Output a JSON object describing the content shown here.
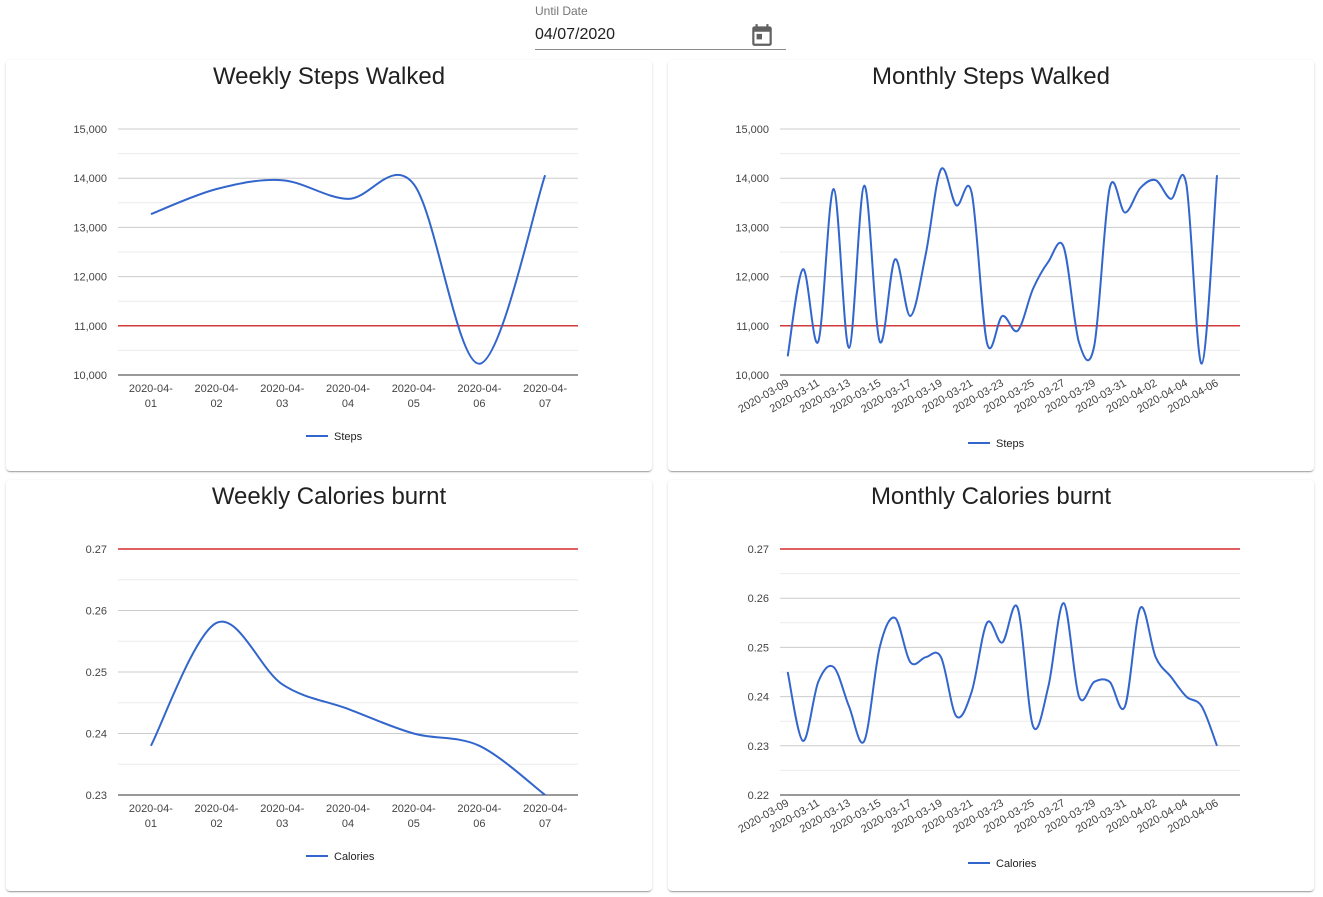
{
  "date_picker": {
    "label": "Until Date",
    "value": "04/07/2020",
    "icon": "calendar-icon"
  },
  "colors": {
    "series": "#3366cc",
    "threshold": "#cc0000",
    "grid": "#cccccc",
    "minor_grid": "#ebebeb"
  },
  "cards": {
    "weekly_steps": {
      "title": "Weekly Steps Walked"
    },
    "monthly_steps": {
      "title": "Monthly Steps Walked"
    },
    "weekly_calories": {
      "title": "Weekly Calories burnt"
    },
    "monthly_calories": {
      "title": "Monthly Calories burnt"
    }
  },
  "chart_data": [
    {
      "id": "weekly_steps",
      "type": "line",
      "title": "Weekly Steps Walked",
      "categories": [
        "2020-04-01",
        "2020-04-02",
        "2020-04-03",
        "2020-04-04",
        "2020-04-05",
        "2020-04-06",
        "2020-04-07"
      ],
      "category_lines": [
        [
          "2020-04-",
          "01"
        ],
        [
          "2020-04-",
          "02"
        ],
        [
          "2020-04-",
          "03"
        ],
        [
          "2020-04-",
          "04"
        ],
        [
          "2020-04-",
          "05"
        ],
        [
          "2020-04-",
          "06"
        ],
        [
          "2020-04-",
          "07"
        ]
      ],
      "series": [
        {
          "name": "Steps",
          "values": [
            13270,
            13780,
            13960,
            13580,
            13880,
            10230,
            14060
          ]
        }
      ],
      "threshold": 11000,
      "ylim": [
        10000,
        15000
      ],
      "yticks": [
        10000,
        11000,
        12000,
        13000,
        14000,
        15000
      ],
      "ytick_labels": [
        "10,000",
        "11,000",
        "12,000",
        "13,000",
        "14,000",
        "15,000"
      ],
      "xlabel_style": "wrap",
      "legend_position": "bottom",
      "grid": true
    },
    {
      "id": "monthly_steps",
      "type": "line",
      "title": "Monthly Steps Walked",
      "categories": [
        "2020-03-09",
        "2020-03-10",
        "2020-03-11",
        "2020-03-12",
        "2020-03-13",
        "2020-03-14",
        "2020-03-15",
        "2020-03-16",
        "2020-03-17",
        "2020-03-18",
        "2020-03-19",
        "2020-03-20",
        "2020-03-21",
        "2020-03-22",
        "2020-03-23",
        "2020-03-24",
        "2020-03-25",
        "2020-03-26",
        "2020-03-27",
        "2020-03-28",
        "2020-03-29",
        "2020-03-30",
        "2020-03-31",
        "2020-04-01",
        "2020-04-02",
        "2020-04-03",
        "2020-04-04",
        "2020-04-05",
        "2020-04-06",
        "2020-04-07"
      ],
      "category_labels": [
        "2020-03-09",
        "",
        "2020-03-11",
        "",
        "2020-03-13",
        "",
        "2020-03-15",
        "",
        "2020-03-17",
        "",
        "2020-03-19",
        "",
        "2020-03-21",
        "",
        "2020-03-23",
        "",
        "2020-03-25",
        "",
        "2020-03-27",
        "",
        "2020-03-29",
        "",
        "2020-03-31",
        "",
        "2020-04-02",
        "",
        "2020-04-04",
        "",
        "2020-04-06",
        ""
      ],
      "series": [
        {
          "name": "Steps",
          "values": [
            10380,
            12150,
            10680,
            13780,
            10550,
            13850,
            10680,
            12350,
            11200,
            12450,
            14180,
            13450,
            13700,
            10650,
            11200,
            10900,
            11750,
            12300,
            12600,
            10660,
            10600,
            13800,
            13300,
            13800,
            13960,
            13580,
            13880,
            10230,
            14060
          ]
        }
      ],
      "threshold": 11000,
      "ylim": [
        10000,
        15000
      ],
      "yticks": [
        10000,
        11000,
        12000,
        13000,
        14000,
        15000
      ],
      "ytick_labels": [
        "10,000",
        "11,000",
        "12,000",
        "13,000",
        "14,000",
        "15,000"
      ],
      "xlabel_style": "rotated",
      "legend_position": "bottom",
      "grid": true
    },
    {
      "id": "weekly_calories",
      "type": "line",
      "title": "Weekly Calories burnt",
      "categories": [
        "2020-04-01",
        "2020-04-02",
        "2020-04-03",
        "2020-04-04",
        "2020-04-05",
        "2020-04-06",
        "2020-04-07"
      ],
      "category_lines": [
        [
          "2020-04-",
          "01"
        ],
        [
          "2020-04-",
          "02"
        ],
        [
          "2020-04-",
          "03"
        ],
        [
          "2020-04-",
          "04"
        ],
        [
          "2020-04-",
          "05"
        ],
        [
          "2020-04-",
          "06"
        ],
        [
          "2020-04-",
          "07"
        ]
      ],
      "series": [
        {
          "name": "Calories",
          "values": [
            0.238,
            0.258,
            0.248,
            0.244,
            0.24,
            0.238,
            0.23
          ]
        }
      ],
      "threshold": 0.27,
      "ylim": [
        0.23,
        0.27
      ],
      "yticks": [
        0.23,
        0.24,
        0.25,
        0.26,
        0.27
      ],
      "ytick_labels": [
        "0.23",
        "0.24",
        "0.25",
        "0.26",
        "0.27"
      ],
      "xlabel_style": "wrap",
      "legend_position": "bottom",
      "grid": true
    },
    {
      "id": "monthly_calories",
      "type": "line",
      "title": "Monthly Calories burnt",
      "categories": [
        "2020-03-09",
        "2020-03-10",
        "2020-03-11",
        "2020-03-12",
        "2020-03-13",
        "2020-03-14",
        "2020-03-15",
        "2020-03-16",
        "2020-03-17",
        "2020-03-18",
        "2020-03-19",
        "2020-03-20",
        "2020-03-21",
        "2020-03-22",
        "2020-03-23",
        "2020-03-24",
        "2020-03-25",
        "2020-03-26",
        "2020-03-27",
        "2020-03-28",
        "2020-03-29",
        "2020-03-30",
        "2020-03-31",
        "2020-04-01",
        "2020-04-02",
        "2020-04-03",
        "2020-04-04",
        "2020-04-05",
        "2020-04-06",
        "2020-04-07"
      ],
      "category_labels": [
        "2020-03-09",
        "",
        "2020-03-11",
        "",
        "2020-03-13",
        "",
        "2020-03-15",
        "",
        "2020-03-17",
        "",
        "2020-03-19",
        "",
        "2020-03-21",
        "",
        "2020-03-23",
        "",
        "2020-03-25",
        "",
        "2020-03-27",
        "",
        "2020-03-29",
        "",
        "2020-03-31",
        "",
        "2020-04-02",
        "",
        "2020-04-04",
        "",
        "2020-04-06",
        ""
      ],
      "series": [
        {
          "name": "Calories",
          "values": [
            0.245,
            0.231,
            0.243,
            0.246,
            0.238,
            0.231,
            0.25,
            0.256,
            0.247,
            0.248,
            0.248,
            0.236,
            0.241,
            0.255,
            0.251,
            0.258,
            0.234,
            0.242,
            0.259,
            0.24,
            0.243,
            0.243,
            0.238,
            0.258,
            0.248,
            0.244,
            0.24,
            0.238,
            0.23
          ]
        }
      ],
      "threshold": 0.27,
      "ylim": [
        0.22,
        0.27
      ],
      "yticks": [
        0.22,
        0.23,
        0.24,
        0.25,
        0.26,
        0.27
      ],
      "ytick_labels": [
        "0.22",
        "0.23",
        "0.24",
        "0.25",
        "0.26",
        "0.27"
      ],
      "xlabel_style": "rotated",
      "legend_position": "bottom",
      "grid": true
    }
  ]
}
